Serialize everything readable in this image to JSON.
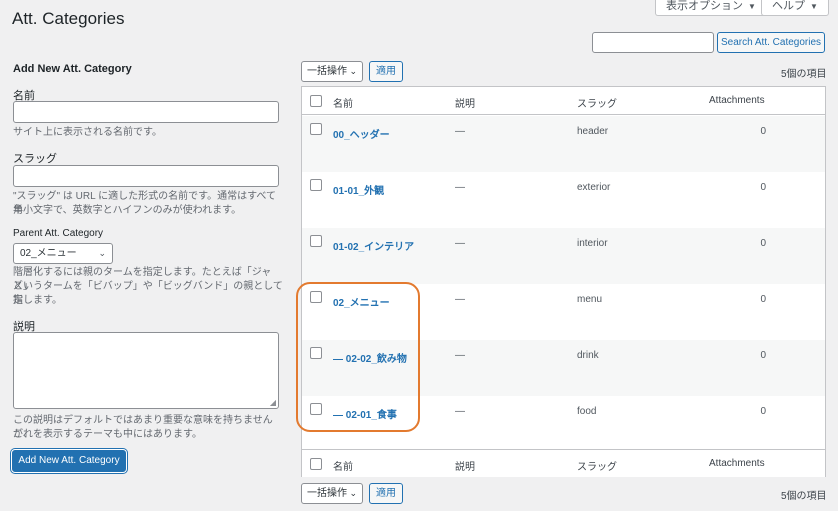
{
  "page": {
    "title": "Att. Categories"
  },
  "top_tabs": {
    "screen_options": "表示オプション",
    "help": "ヘルプ"
  },
  "search": {
    "button": "Search Att. Categories",
    "value": ""
  },
  "form": {
    "heading": "Add New Att. Category",
    "name_label": "名前",
    "name_help": "サイト上に表示される名前です。",
    "slug_label": "スラッグ",
    "slug_help_1": "\"スラッグ\" は URL に適した形式の名前です。通常はすべて半",
    "slug_help_2": "角小文字で、英数字とハイフンのみが使われます。",
    "parent_label": "Parent Att. Category",
    "parent_selected": "02_メニュー",
    "parent_help_1": "階層化するには親のタームを指定します。たとえば「ジャズ」",
    "parent_help_2": "というタームを「ビバップ」や「ビッグバンド」の親として指",
    "parent_help_3": "定します。",
    "desc_label": "説明",
    "desc_help_1": "この説明はデフォルトではあまり重要な意味を持ちませんが、",
    "desc_help_2": "これを表示するテーマも中にはあります。",
    "submit": "Add New Att. Category"
  },
  "bulk": {
    "label": "一括操作",
    "apply": "適用",
    "count": "5個の項目"
  },
  "table": {
    "headers": {
      "name": "名前",
      "description": "説明",
      "slug": "スラッグ",
      "count": "Attachments"
    },
    "rows": [
      {
        "name": "00_ヘッダー",
        "description": "—",
        "slug": "header",
        "count": "0"
      },
      {
        "name": "01-01_外観",
        "description": "—",
        "slug": "exterior",
        "count": "0"
      },
      {
        "name": "01-02_インテリア",
        "description": "—",
        "slug": "interior",
        "count": "0"
      },
      {
        "name": "02_メニュー",
        "description": "—",
        "slug": "menu",
        "count": "0"
      },
      {
        "name": "— 02-02_飲み物",
        "description": "—",
        "slug": "drink",
        "count": "0"
      },
      {
        "name": "— 02-01_食事",
        "description": "—",
        "slug": "food",
        "count": "0"
      }
    ]
  },
  "colors": {
    "accent": "#2271b1",
    "highlight": "#e37a2f"
  }
}
